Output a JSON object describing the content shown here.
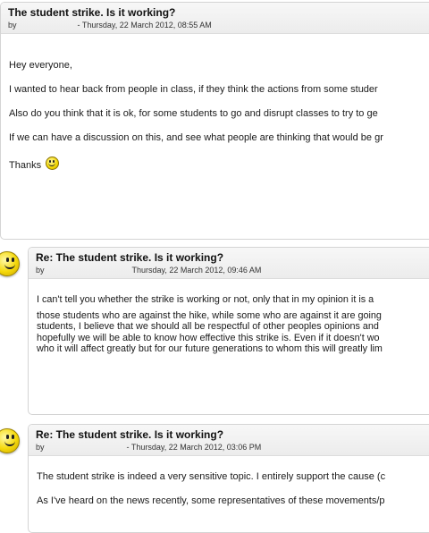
{
  "posts": [
    {
      "title": "The student strike. Is it working?",
      "by": "by",
      "date": "- Thursday, 22 March 2012, 08:55 AM",
      "greeting": "Hey everyone,",
      "p1": "I wanted to hear back from people in class, if they think the actions from some studer",
      "p2": "Also do you think that it is ok, for some students to go and disrupt classes to try to ge",
      "p3": "If we can have a discussion on this, and see what people are thinking that would be gr",
      "signoff": "Thanks"
    },
    {
      "title": "Re: The student strike. Is it working?",
      "by": "by",
      "date": "Thursday, 22 March 2012, 09:46 AM",
      "lines": [
        "I can't tell you whether the strike is working or not, only that in my opinion it is a",
        "those students who are against the hike, while some who are against it are going",
        "students, I believe that we should all be respectful of other peoples opinions and",
        "hopefully we will be able to know how effective this strike is. Even if it doesn't wo",
        "who it will affect greatly but for our future generations to whom this will greatly lim"
      ]
    },
    {
      "title": "Re: The student strike. Is it working?",
      "by": "by",
      "date": "- Thursday, 22 March 2012, 03:06 PM",
      "p1": "The student strike is indeed a very sensitive topic. I entirely support the cause (c",
      "p2": "As I've heard on the news recently, some representatives of these movements/p"
    }
  ],
  "icons": {
    "smiley": "smiley-icon",
    "avatar": "smiley-avatar-icon"
  },
  "colors": {
    "header_bg": "#ececec",
    "border": "#d4d4d4",
    "avatar_yellow": "#f5d90a"
  }
}
